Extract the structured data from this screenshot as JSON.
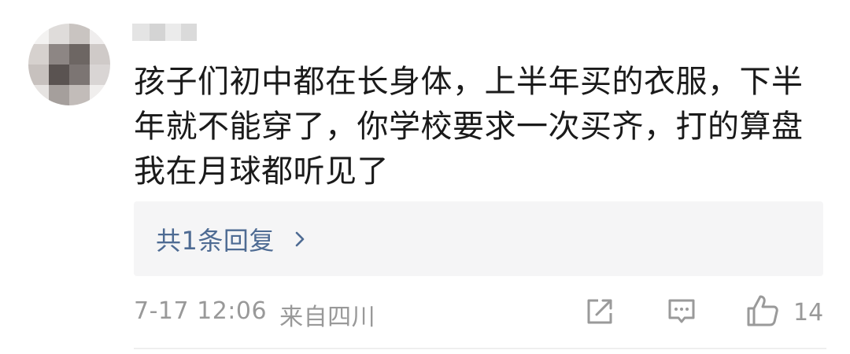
{
  "comment": {
    "text": "孩子们初中都在长身体，上半年买的衣服，下半年就不能穿了，你学校要求一次买齐，打的算盘我在月球都听见了",
    "reply_summary": "共1条回复",
    "date": "7-17 12:06",
    "location": "来自四川",
    "like_count": "14"
  },
  "icons": {
    "reply_chevron": "chevron-right-icon",
    "share": "share-icon",
    "reply": "comment-icon",
    "like": "thumbs-up-icon"
  },
  "colors": {
    "text": "#1a1a1a",
    "link": "#4e6b93",
    "meta": "#999999",
    "reply_box": "#f5f5f6"
  }
}
